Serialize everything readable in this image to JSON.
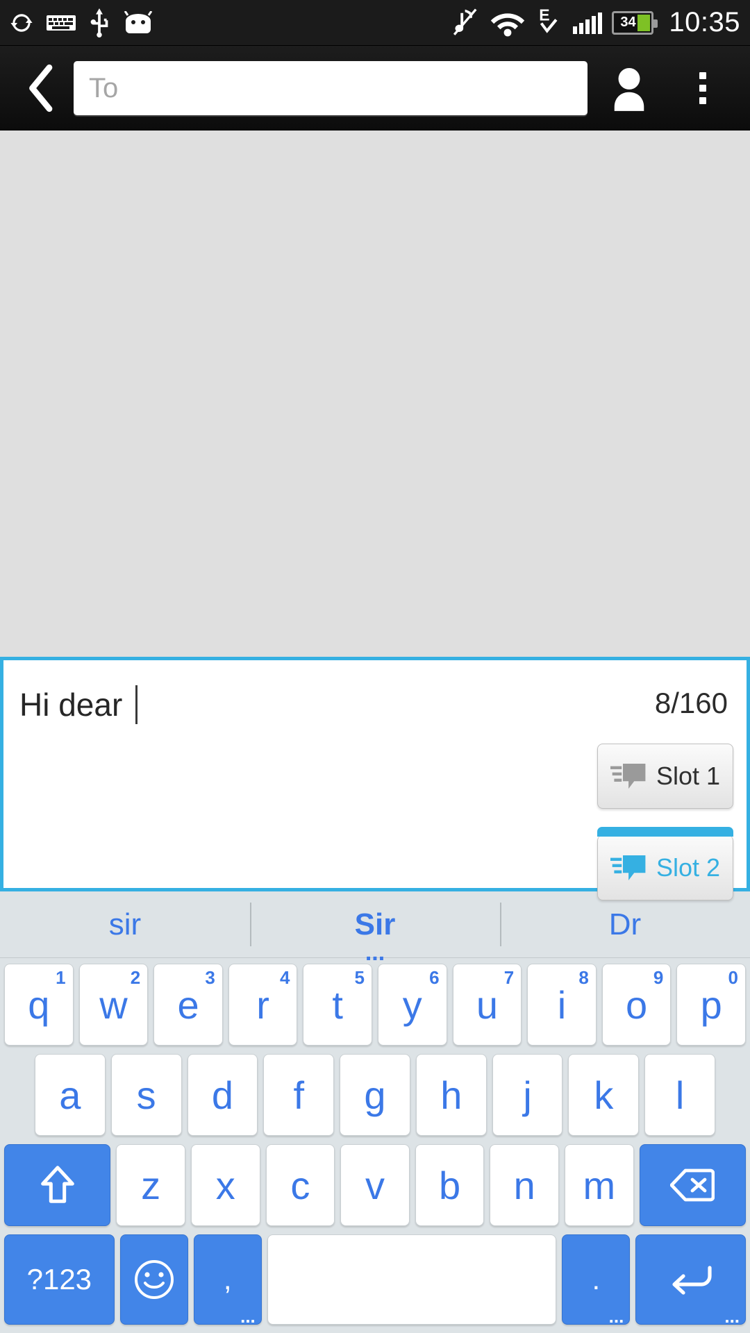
{
  "status_bar": {
    "left_icons": [
      "sync-icon",
      "keyboard-icon",
      "usb-icon",
      "android-robot-icon"
    ],
    "right_icons": [
      "music-muted-icon",
      "wifi-icon",
      "edge-data-icon",
      "signal-bars-icon"
    ],
    "battery_percent": "34",
    "battery_level": 34,
    "time": "10:35"
  },
  "action_bar": {
    "back_label": "Back",
    "recipient_value": "",
    "recipient_placeholder": "To",
    "contacts_label": "Contacts",
    "overflow_label": "More options"
  },
  "compose": {
    "message": "Hi dear ",
    "counter": "8/160",
    "slots": [
      {
        "label": "Slot 1",
        "active": false
      },
      {
        "label": "Slot 2",
        "active": true
      }
    ]
  },
  "suggestions": [
    {
      "text": "sir",
      "bold": false,
      "has_more": false
    },
    {
      "text": "Sir",
      "bold": true,
      "has_more": true
    },
    {
      "text": "Dr",
      "bold": false,
      "has_more": false
    }
  ],
  "keyboard": {
    "row1": [
      {
        "k": "q",
        "n": "1"
      },
      {
        "k": "w",
        "n": "2"
      },
      {
        "k": "e",
        "n": "3"
      },
      {
        "k": "r",
        "n": "4"
      },
      {
        "k": "t",
        "n": "5"
      },
      {
        "k": "y",
        "n": "6"
      },
      {
        "k": "u",
        "n": "7"
      },
      {
        "k": "i",
        "n": "8"
      },
      {
        "k": "o",
        "n": "9"
      },
      {
        "k": "p",
        "n": "0"
      }
    ],
    "row2": [
      {
        "k": "a"
      },
      {
        "k": "s"
      },
      {
        "k": "d"
      },
      {
        "k": "f"
      },
      {
        "k": "g"
      },
      {
        "k": "h"
      },
      {
        "k": "j"
      },
      {
        "k": "k"
      },
      {
        "k": "l"
      }
    ],
    "row3": [
      {
        "k": "z"
      },
      {
        "k": "x"
      },
      {
        "k": "c"
      },
      {
        "k": "v"
      },
      {
        "k": "b"
      },
      {
        "k": "n"
      },
      {
        "k": "m"
      }
    ],
    "shift_label": "Shift",
    "backspace_label": "Delete",
    "symbols_label": "?123",
    "emoji_label": "Emoji",
    "comma_label": ",",
    "space_label": "",
    "period_label": ".",
    "enter_label": "Enter",
    "more_hint": "..."
  },
  "colors": {
    "accent_cyan": "#35b0e2",
    "key_blue": "#4285e8",
    "letter_blue": "#3b78e7",
    "keyboard_bg": "#dde3e6",
    "thread_bg": "#dfdfdf",
    "battery_green": "#7ec125"
  }
}
